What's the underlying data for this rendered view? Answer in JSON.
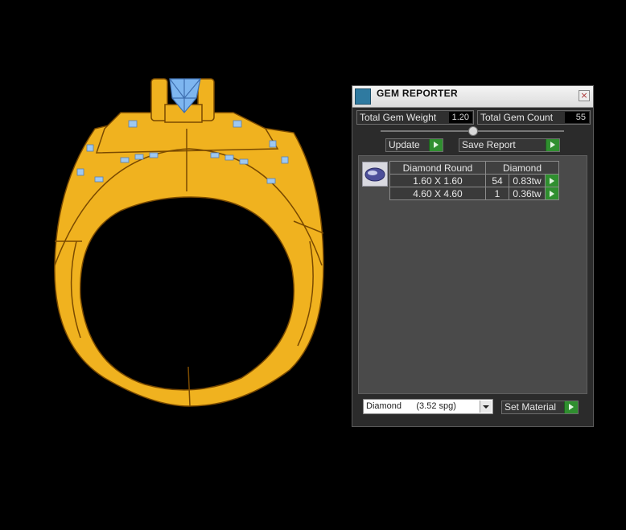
{
  "panel": {
    "title": "GEM REPORTER",
    "close": "×",
    "total_weight_label": "Total Gem Weight",
    "total_weight_value": "1.20",
    "total_count_label": "Total Gem Count",
    "total_count_value": "55",
    "update_label": "Update",
    "save_report_label": "Save Report",
    "table": {
      "header_shape": "Diamond Round",
      "header_material": "Diamond",
      "rows": [
        {
          "size": "1.60 X 1.60",
          "count": "54",
          "weight": "0.83tw"
        },
        {
          "size": "4.60 X 4.60",
          "count": "1",
          "weight": "0.36tw"
        }
      ]
    },
    "material_select_value": "Diamond      (3.52 spg)",
    "set_material_label": "Set Material"
  },
  "colors": {
    "ring_gold": "#F0B21F",
    "ring_outline": "#7a4a00",
    "gem_blue": "#7EB6F0",
    "accent_green": "#2f8f2f"
  },
  "icons": {
    "app": "gem-reporter-icon",
    "go": "green-play-arrow-icon",
    "gem": "round-diamond-icon"
  }
}
